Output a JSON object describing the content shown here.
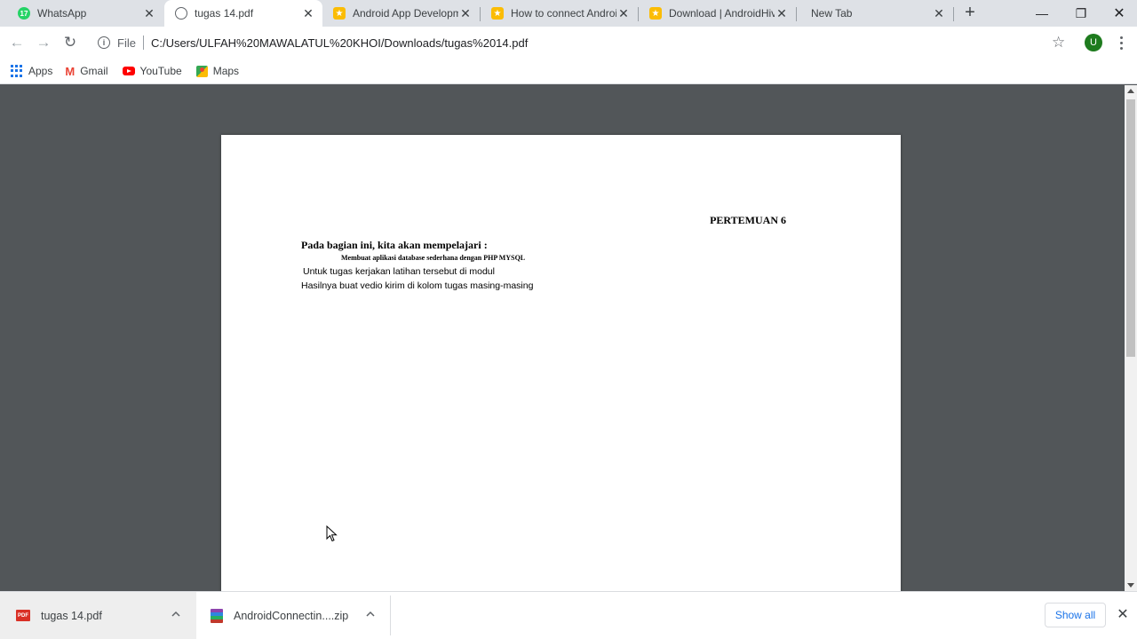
{
  "tabs": [
    {
      "title": "WhatsApp",
      "favicon": "whatsapp-icon",
      "badge": "17",
      "active": false
    },
    {
      "title": "tugas 14.pdf",
      "favicon": "globe-icon",
      "active": true
    },
    {
      "title": "Android App Developm",
      "favicon": "bookmark-star-icon",
      "active": false
    },
    {
      "title": "How to connect Androi",
      "favicon": "bookmark-star-icon",
      "active": false
    },
    {
      "title": "Download | AndroidHiv",
      "favicon": "bookmark-star-icon",
      "active": false
    },
    {
      "title": "New Tab",
      "favicon": "",
      "active": false
    }
  ],
  "toolbar": {
    "scheme": "File",
    "url": "C:/Users/ULFAH%20MAWALATUL%20KHOI/Downloads/tugas%2014.pdf",
    "avatar_letter": "U",
    "avatar_color": "#1e7b1e"
  },
  "bookmarks": [
    {
      "label": "Apps",
      "icon": "apps-grid-icon"
    },
    {
      "label": "Gmail",
      "icon": "gmail-icon"
    },
    {
      "label": "YouTube",
      "icon": "youtube-icon"
    },
    {
      "label": "Maps",
      "icon": "maps-icon"
    }
  ],
  "document": {
    "heading": "PERTEMUAN 6",
    "intro": "Pada bagian ini, kita akan mempelajari :",
    "item": "Membuat aplikasi database sederhana dengan PHP MYSQL",
    "line1": "Untuk tugas kerjakan latihan tersebut di modul",
    "line2": "Hasilnya buat vedio kirim di kolom tugas masing-masing"
  },
  "downloads": {
    "items": [
      {
        "name": "tugas 14.pdf",
        "icon": "pdf-file-icon"
      },
      {
        "name": "AndroidConnectin....zip",
        "icon": "zip-file-icon"
      }
    ],
    "show_all_label": "Show all"
  },
  "colors": {
    "viewer_background": "#525659",
    "tab_strip": "#dee1e6",
    "accent": "#1a73e8"
  }
}
